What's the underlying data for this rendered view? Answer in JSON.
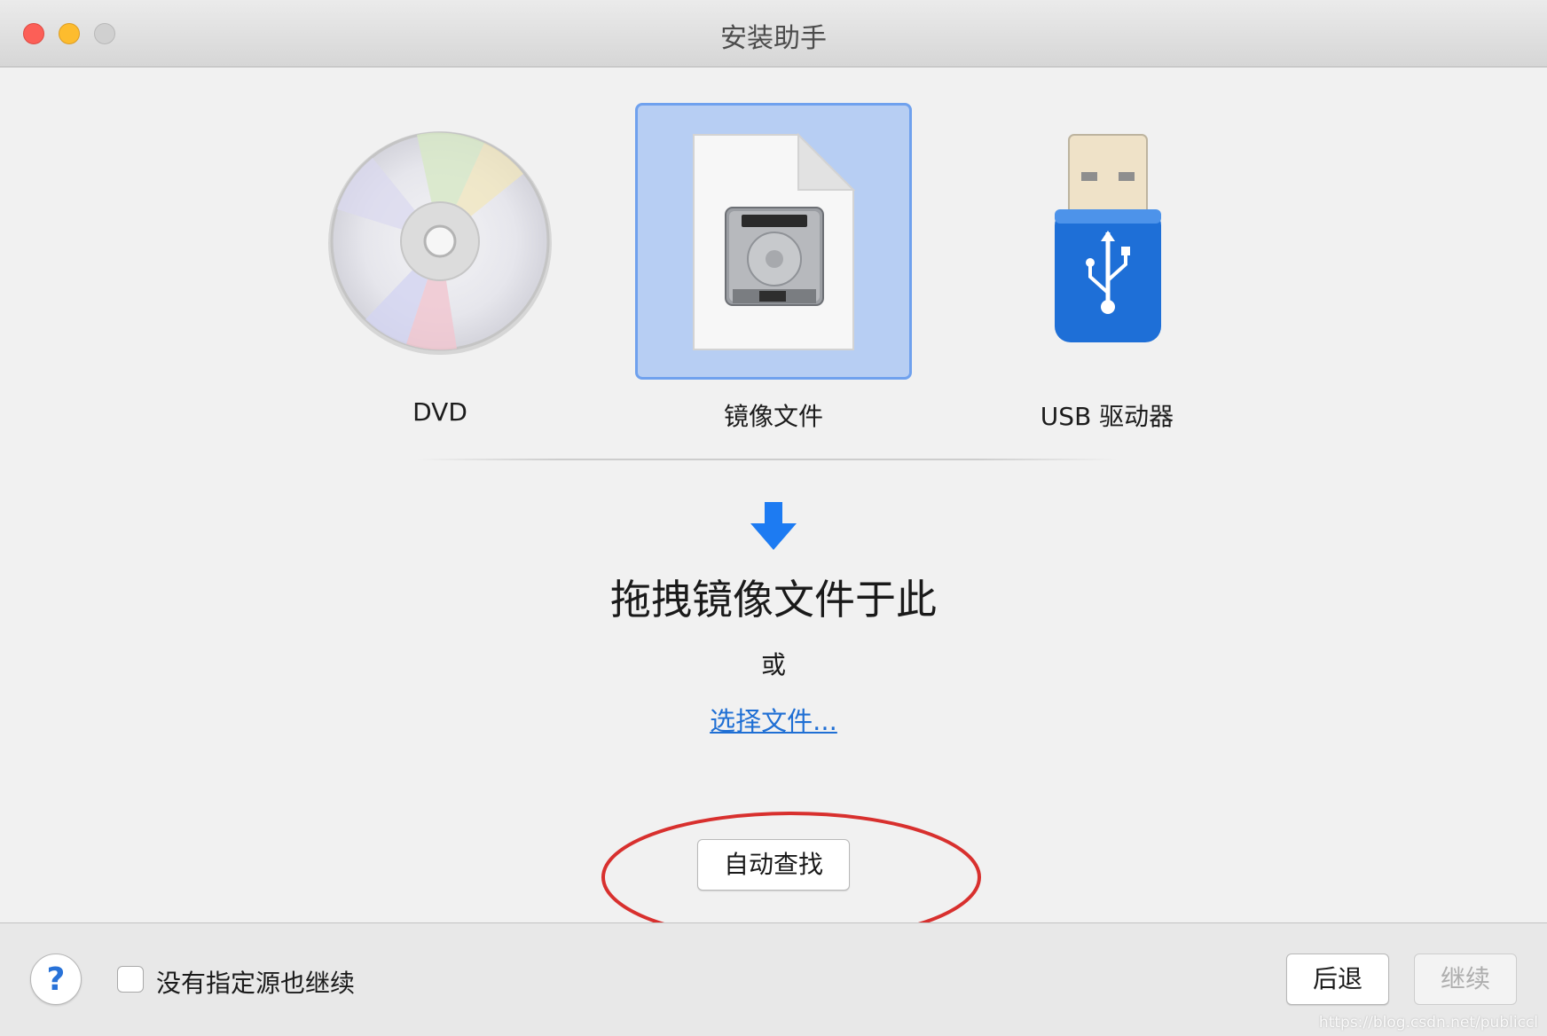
{
  "window": {
    "title": "安装助手",
    "controls": [
      "close",
      "minimize",
      "zoom"
    ]
  },
  "sources": [
    {
      "label": "DVD",
      "icon": "dvd-disc-icon",
      "selected": false
    },
    {
      "label": "镜像文件",
      "icon": "disk-image-file-icon",
      "selected": true
    },
    {
      "label": "USB 驱动器",
      "icon": "usb-drive-icon",
      "selected": false
    }
  ],
  "drop_zone": {
    "icon": "down-arrow-icon",
    "title": "拖拽镜像文件于此",
    "or_text": "或",
    "choose_link": "选择文件..."
  },
  "auto_find_button": "自动查找",
  "footer": {
    "help_label": "?",
    "checkbox_label": "没有指定源也继续",
    "checkbox_checked": false,
    "back_label": "后退",
    "continue_label": "继续",
    "continue_enabled": false
  },
  "watermark": "https://blog.csdn.net/publiccl",
  "colors": {
    "selection_fill": "#b7cef3",
    "selection_border": "#6fa1ee",
    "link": "#1f6fd4",
    "arrow": "#1d7bf2",
    "annotation": "#d8302e"
  }
}
